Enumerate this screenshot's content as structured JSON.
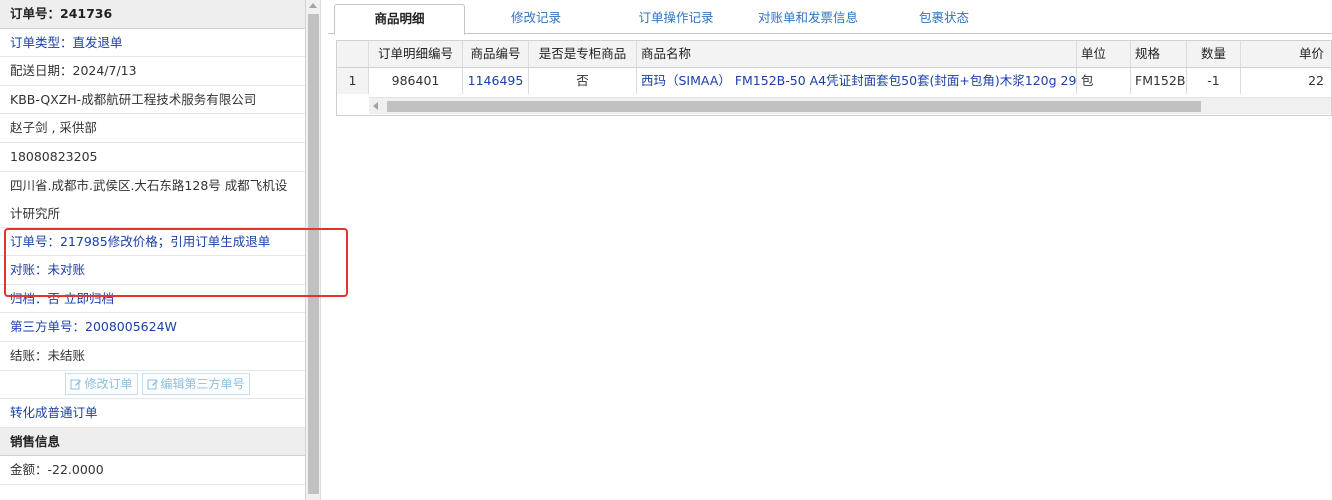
{
  "order_panel": {
    "title": "订单号：241736",
    "order_type": "订单类型：直发退单",
    "delivery_date": "配送日期：2024/7/13",
    "company": "KBB-QXZH-成都航研工程技术服务有限公司",
    "contact": "赵子剑 , 采供部",
    "phone": "18080823205",
    "address": "四川省.成都市.武侯区.大石东路128号 成都飞机设计研究所",
    "remark": "订单号：217985修改价格；引用订单生成退单",
    "reconcile": "对账：未对账",
    "archive_label": "归档：",
    "archive_value": "否",
    "archive_action": "立即归档",
    "third_party_no": "第三方单号：2008005624W",
    "settlement": "结账：未结账",
    "edit_order_button": "修改订单",
    "edit_third_party_button": "编辑第三方单号",
    "convert_link": "转化成普通订单",
    "sales_header": "销售信息",
    "amount": "金额：-22.0000"
  },
  "tabs": [
    {
      "label": "商品明细",
      "active": true
    },
    {
      "label": "修改记录",
      "active": false
    },
    {
      "label": "订单操作记录",
      "active": false
    },
    {
      "label": "对账单和发票信息",
      "active": false
    },
    {
      "label": "包裹状态",
      "active": false
    }
  ],
  "table": {
    "columns": [
      "",
      "订单明细编号",
      "商品编号",
      "是否是专柜商品",
      "商品名称",
      "单位",
      "规格",
      "数量",
      "单价"
    ],
    "rows": [
      [
        "1",
        "986401",
        "1146495",
        "否",
        "西玛（SIMAA） FM152B-50 A4凭证封面套包50套(封面+包角)木浆120g 29",
        "包",
        "FM152B",
        "-1",
        "22"
      ]
    ]
  },
  "colors": {
    "link": "#1a3fa8",
    "tab_text": "#2f73c0",
    "highlight": "#e53333"
  }
}
